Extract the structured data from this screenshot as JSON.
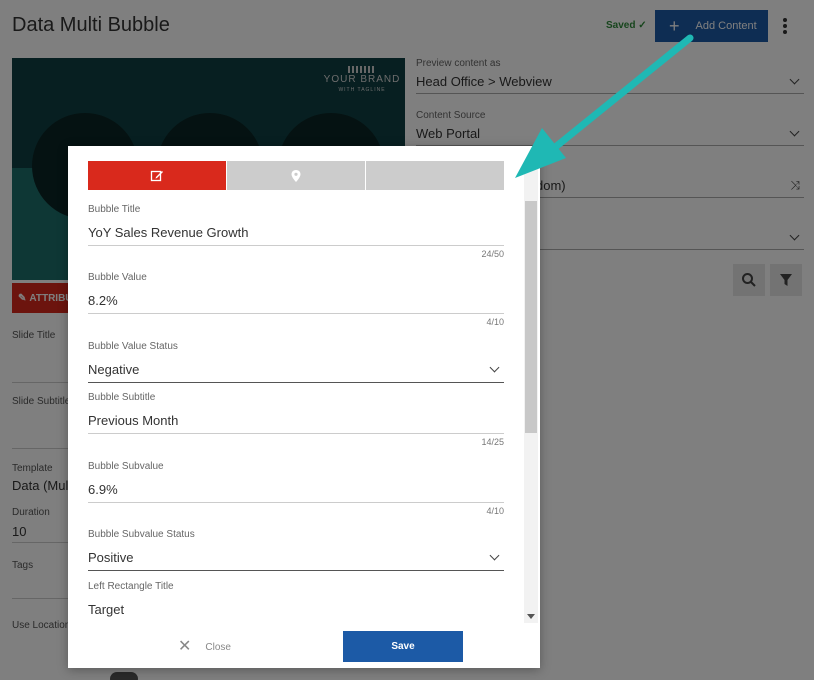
{
  "page": {
    "title": "Data Multi Bubble",
    "saved_label": "Saved",
    "add_content_label": "Add Content",
    "attribute_label": "ATTRIBU",
    "brand": "YOUR BRAND",
    "brand_sub": "WITH TAGLINE"
  },
  "left_form": {
    "slide_title_label": "Slide Title",
    "slide_subtitle_label": "Slide Subtitle",
    "template_label": "Template",
    "template_value": "Data (Mul",
    "duration_label": "Duration",
    "duration_value": "10",
    "tags_label": "Tags",
    "use_location_label": "Use Location"
  },
  "right_form": {
    "preview_label": "Preview content as",
    "preview_value": "Head Office > Webview",
    "source_label": "Content Source",
    "source_value": "Web Portal",
    "third_value": "dom)"
  },
  "modal": {
    "fields": [
      {
        "label": "Bubble Title",
        "value": "YoY Sales Revenue Growth",
        "count": "24/50",
        "type": "text"
      },
      {
        "label": "Bubble Value",
        "value": "8.2%",
        "count": "4/10",
        "type": "text"
      },
      {
        "label": "Bubble Value Status",
        "value": "Negative",
        "count": "",
        "type": "select"
      },
      {
        "label": "Bubble Subtitle",
        "value": "Previous Month",
        "count": "14/25",
        "type": "text"
      },
      {
        "label": "Bubble Subvalue",
        "value": "6.9%",
        "count": "4/10",
        "type": "text"
      },
      {
        "label": "Bubble Subvalue Status",
        "value": "Positive",
        "count": "",
        "type": "select"
      },
      {
        "label": "Left Rectangle Title",
        "value": "Target",
        "count": "",
        "type": "text"
      }
    ],
    "close_label": "Close",
    "save_label": "Save"
  },
  "colors": {
    "accent_red": "#d9291c",
    "primary_blue": "#1c5aa6",
    "arrow_teal": "#1fb8b4",
    "tab_inactive": "#cccccc"
  },
  "icons": {
    "tab_edit": "edit-icon",
    "tab_location": "location-pin-icon"
  }
}
